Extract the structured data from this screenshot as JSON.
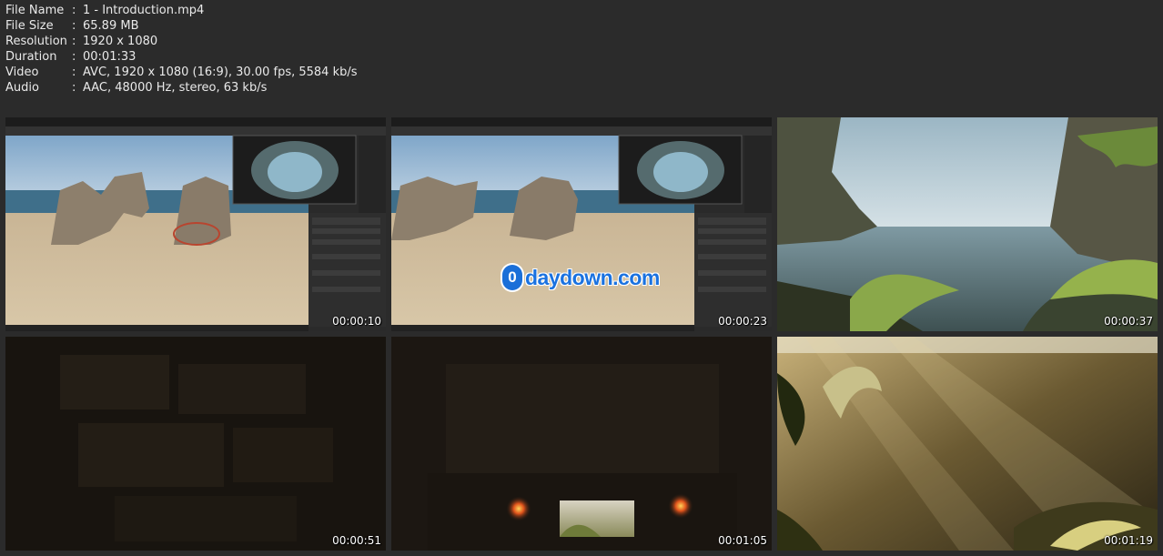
{
  "file_info": {
    "rows": [
      {
        "key": "File Name",
        "sep": ":",
        "value": "1 - Introduction.mp4"
      },
      {
        "key": "File Size",
        "sep": ":",
        "value": "65.89 MB"
      },
      {
        "key": "Resolution",
        "sep": ":",
        "value": "1920 x 1080"
      },
      {
        "key": "Duration",
        "sep": ":",
        "value": "00:01:33"
      },
      {
        "key": "Video",
        "sep": ":",
        "value": "AVC, 1920 x 1080 (16:9), 30.00 fps, 5584 kb/s"
      },
      {
        "key": "Audio",
        "sep": ":",
        "value": "AAC, 48000 Hz, stereo, 63 kb/s"
      }
    ]
  },
  "thumbnails": [
    {
      "timestamp": "00:00:10",
      "scene": "editor-rocks-beach"
    },
    {
      "timestamp": "00:00:23",
      "scene": "editor-rock-beach-watermark"
    },
    {
      "timestamp": "00:00:37",
      "scene": "lagoon-cove"
    },
    {
      "timestamp": "00:00:51",
      "scene": "dark-cave-wall"
    },
    {
      "timestamp": "00:01:05",
      "scene": "cave-doorway-torches"
    },
    {
      "timestamp": "00:01:19",
      "scene": "jungle-sunrays"
    }
  ],
  "watermark": {
    "logo": "0",
    "text": "daydown.com"
  },
  "colors": {
    "background": "#2b2b2b",
    "info_text": "#e9e9e9",
    "timestamp": "#ffffff",
    "watermark_blue": "#1a72e0"
  }
}
